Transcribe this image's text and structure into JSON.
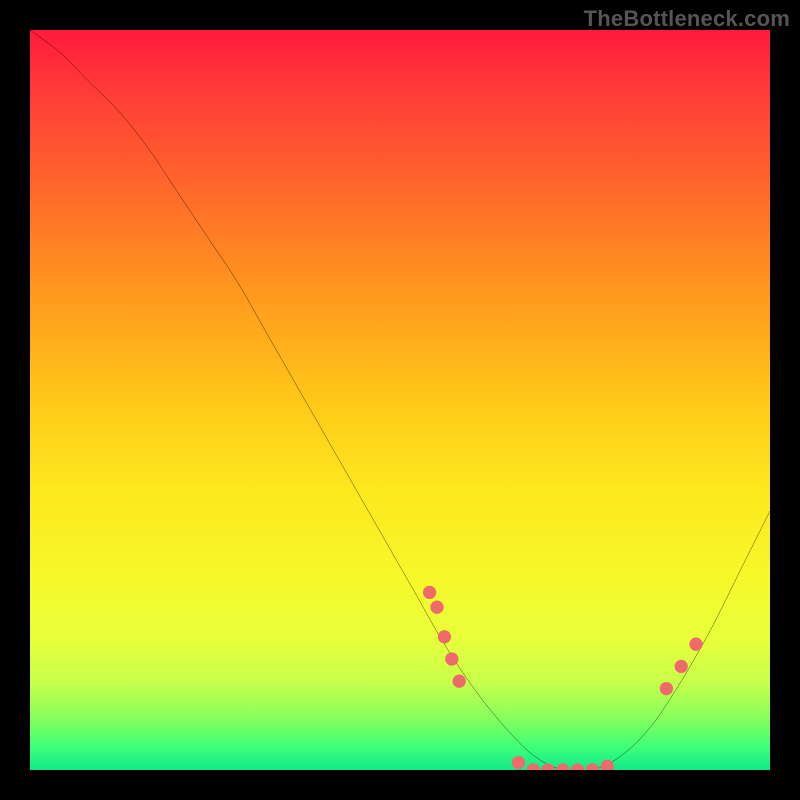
{
  "watermark": "TheBottleneck.com",
  "chart_data": {
    "type": "line",
    "title": "",
    "xlabel": "",
    "ylabel": "",
    "xlim": [
      0,
      100
    ],
    "ylim": [
      0,
      100
    ],
    "background_gradient": {
      "top": "#ff1a3c",
      "mid": "#fde81e",
      "bottom": "#12e88a"
    },
    "series": [
      {
        "name": "curve",
        "color": "#000000",
        "x": [
          0,
          4,
          8,
          12,
          16,
          20,
          24,
          28,
          32,
          36,
          40,
          44,
          48,
          52,
          56,
          60,
          64,
          68,
          72,
          76,
          80,
          84,
          88,
          92,
          96,
          100
        ],
        "y": [
          100,
          97,
          93,
          89,
          84,
          78,
          72,
          66,
          59,
          52,
          45,
          38,
          31,
          24,
          17,
          11,
          6,
          2,
          0,
          0,
          2,
          6,
          12,
          19,
          27,
          35
        ]
      }
    ],
    "markers": {
      "name": "highlighted-points",
      "color": "#ef6a6a",
      "points": [
        {
          "x": 54,
          "y": 24
        },
        {
          "x": 55,
          "y": 22
        },
        {
          "x": 56,
          "y": 18
        },
        {
          "x": 57,
          "y": 15
        },
        {
          "x": 58,
          "y": 12
        },
        {
          "x": 66,
          "y": 1
        },
        {
          "x": 68,
          "y": 0
        },
        {
          "x": 70,
          "y": 0
        },
        {
          "x": 72,
          "y": 0
        },
        {
          "x": 74,
          "y": 0
        },
        {
          "x": 76,
          "y": 0
        },
        {
          "x": 78,
          "y": 0.5
        },
        {
          "x": 86,
          "y": 11
        },
        {
          "x": 88,
          "y": 14
        },
        {
          "x": 90,
          "y": 17
        }
      ]
    }
  }
}
